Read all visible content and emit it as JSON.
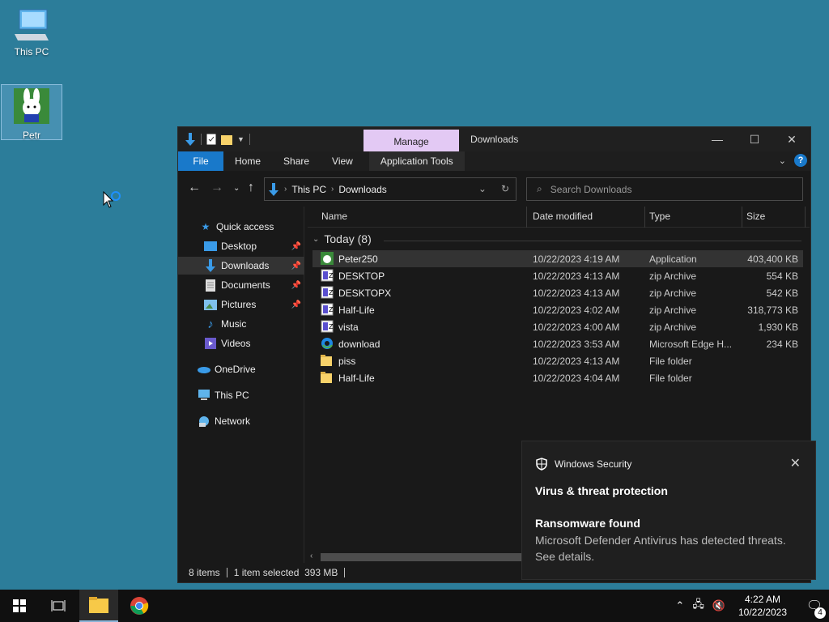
{
  "desktop": {
    "icons": [
      {
        "label": "This PC"
      },
      {
        "label": "Petr"
      }
    ]
  },
  "explorer": {
    "title": "Downloads",
    "manage_tab": "Manage",
    "ribbon_tabs": [
      "File",
      "Home",
      "Share",
      "View",
      "Application Tools"
    ],
    "address": {
      "root": "This PC",
      "folder": "Downloads"
    },
    "search_placeholder": "Search Downloads",
    "nav": {
      "quick_access": "Quick access",
      "items": [
        "Desktop",
        "Downloads",
        "Documents",
        "Pictures",
        "Music",
        "Videos"
      ],
      "onedrive": "OneDrive",
      "thispc": "This PC",
      "network": "Network"
    },
    "columns": {
      "name": "Name",
      "date": "Date modified",
      "type": "Type",
      "size": "Size"
    },
    "group_label": "Today (8)",
    "files": [
      {
        "name": "Peter250",
        "date": "10/22/2023 4:19 AM",
        "type": "Application",
        "size": "403,400 KB",
        "icon": "app-icon"
      },
      {
        "name": "DESKTOP",
        "date": "10/22/2023 4:13 AM",
        "type": "zip Archive",
        "size": "554 KB",
        "icon": "zip-icon"
      },
      {
        "name": "DESKTOPX",
        "date": "10/22/2023 4:13 AM",
        "type": "zip Archive",
        "size": "542 KB",
        "icon": "zip-icon"
      },
      {
        "name": "Half-Life",
        "date": "10/22/2023 4:02 AM",
        "type": "zip Archive",
        "size": "318,773 KB",
        "icon": "zip-icon"
      },
      {
        "name": "vista",
        "date": "10/22/2023 4:00 AM",
        "type": "zip Archive",
        "size": "1,930 KB",
        "icon": "zip-icon"
      },
      {
        "name": "download",
        "date": "10/22/2023 3:53 AM",
        "type": "Microsoft Edge H...",
        "size": "234 KB",
        "icon": "edge-icon"
      },
      {
        "name": "piss",
        "date": "10/22/2023 4:13 AM",
        "type": "File folder",
        "size": "",
        "icon": "folder-icon"
      },
      {
        "name": "Half-Life",
        "date": "10/22/2023 4:04 AM",
        "type": "File folder",
        "size": "",
        "icon": "folder-icon"
      }
    ],
    "status": {
      "count": "8 items",
      "selection": "1 item selected  393 MB"
    }
  },
  "toast": {
    "app": "Windows Security",
    "heading": "Virus & threat protection",
    "subheading": "Ransomware found",
    "body": "Microsoft Defender Antivirus has detected threats.  See details."
  },
  "taskbar": {
    "time": "4:22 AM",
    "date": "10/22/2023",
    "notification_count": "4"
  },
  "colors": {
    "desktop": "#2c7d9a",
    "accent": "#1979ca",
    "manage_tab": "#e3c9f4"
  }
}
